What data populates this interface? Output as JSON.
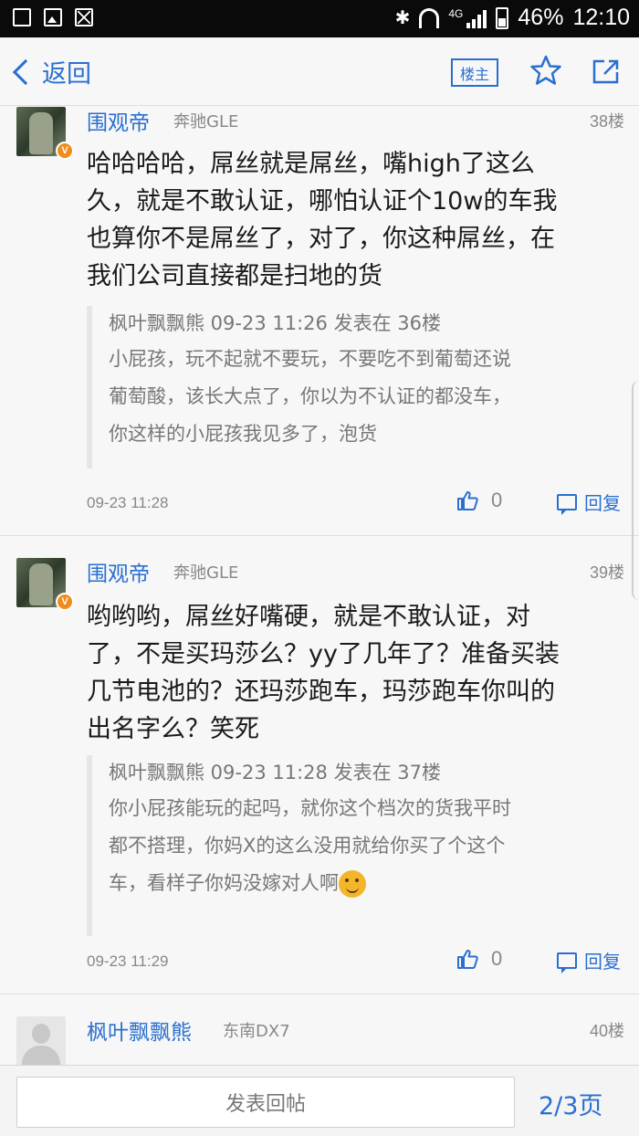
{
  "status_bar": {
    "network": "4G",
    "battery": "46%",
    "time": "12:10"
  },
  "header": {
    "back_label": "返回",
    "op_filter_label": "楼主"
  },
  "posts": [
    {
      "username": "围观帝",
      "car": "奔驰GLE",
      "floor": "38楼",
      "verified_badge": "V",
      "text_lines": [
        "哈哈哈哈，屌丝就是屌丝，嘴high了这么",
        "久，就是不敢认证，哪怕认证个10w的车我",
        "也算你不是屌丝了，对了，你这种屌丝，在",
        "我们公司直接都是扫地的货"
      ],
      "quote": {
        "meta": "枫叶飘飘熊 09-23 11:26 发表在 36楼",
        "lines": [
          "小屁孩，玩不起就不要玩，不要吃不到葡萄还说",
          "葡萄酸，该长大点了，你以为不认证的都没车，",
          "你这样的小屁孩我见多了，泡货"
        ]
      },
      "time": "09-23 11:28",
      "likes": "0",
      "reply_label": "回复"
    },
    {
      "username": "围观帝",
      "car": "奔驰GLE",
      "floor": "39楼",
      "verified_badge": "V",
      "text_lines": [
        "哟哟哟，屌丝好嘴硬，就是不敢认证，对",
        "了，不是买玛莎么？yy了几年了？准备买装",
        "几节电池的？还玛莎跑车，玛莎跑车你叫的",
        "出名字么？笑死"
      ],
      "quote": {
        "meta": "枫叶飘飘熊 09-23 11:28 发表在 37楼",
        "lines": [
          "你小屁孩能玩的起吗，就你这个档次的货我平时",
          "都不搭理，你妈X的这么没用就给你买了个这个",
          "车，看样子你妈没嫁对人啊"
        ]
      },
      "time": "09-23 11:29",
      "likes": "0",
      "reply_label": "回复"
    },
    {
      "username": "枫叶飘飘熊",
      "car": "东南DX7",
      "floor": "40楼"
    }
  ],
  "bottom_bar": {
    "reply_placeholder": "发表回帖",
    "page_indicator": "2/3页"
  },
  "colors": {
    "accent": "#2a6fd0",
    "badge": "#f08c1a"
  }
}
